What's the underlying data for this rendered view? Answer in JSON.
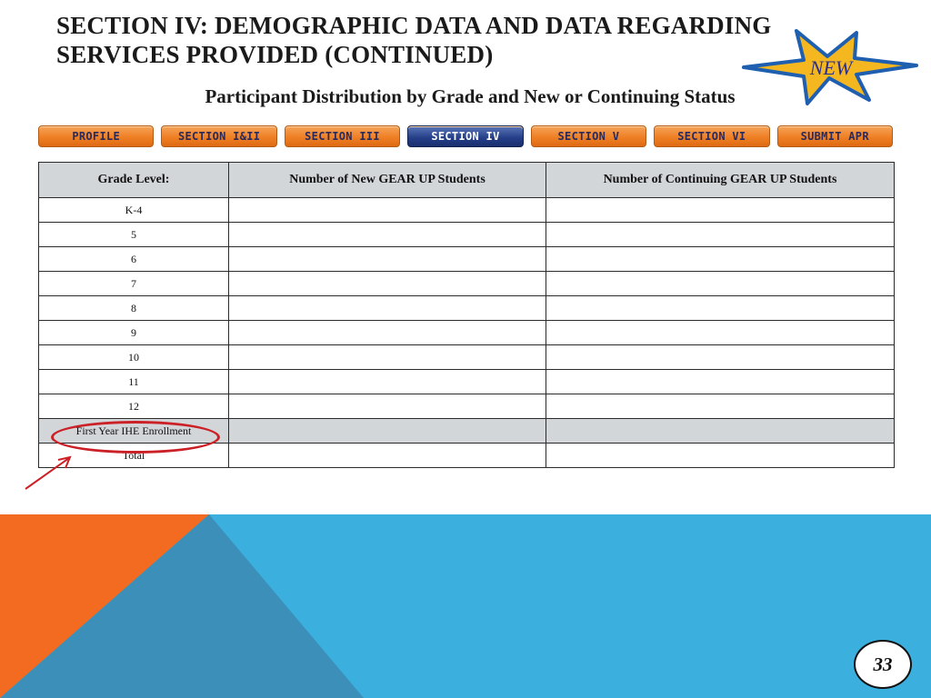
{
  "title": "SECTION IV: DEMOGRAPHIC DATA AND DATA REGARDING SERVICES PROVIDED (CONTINUED)",
  "subtitle": "Participant Distribution by Grade and New or Continuing Status",
  "badge": {
    "label": "NEW",
    "icon": "starburst-icon"
  },
  "nav": {
    "tabs": [
      {
        "label": "PROFILE"
      },
      {
        "label": "SECTION I&II"
      },
      {
        "label": "SECTION III"
      },
      {
        "label": "SECTION IV",
        "active": true
      },
      {
        "label": "SECTION V"
      },
      {
        "label": "SECTION VI"
      },
      {
        "label": "SUBMIT APR"
      }
    ]
  },
  "table": {
    "headers": [
      "Grade Level:",
      "Number of New GEAR UP Students",
      "Number of Continuing GEAR UP Students"
    ],
    "rows": [
      {
        "grade": "K-4",
        "new": "",
        "continuing": ""
      },
      {
        "grade": "5",
        "new": "",
        "continuing": ""
      },
      {
        "grade": "6",
        "new": "",
        "continuing": ""
      },
      {
        "grade": "7",
        "new": "",
        "continuing": ""
      },
      {
        "grade": "8",
        "new": "",
        "continuing": ""
      },
      {
        "grade": "9",
        "new": "",
        "continuing": ""
      },
      {
        "grade": "10",
        "new": "",
        "continuing": ""
      },
      {
        "grade": "11",
        "new": "",
        "continuing": ""
      },
      {
        "grade": "12",
        "new": "",
        "continuing": ""
      },
      {
        "grade": "First Year IHE Enrollment",
        "new": "",
        "continuing": "",
        "shaded": true,
        "highlighted": true
      },
      {
        "grade": "Total",
        "new": "",
        "continuing": ""
      }
    ]
  },
  "page_number": "33",
  "colors": {
    "accent_orange": "#f26b21",
    "accent_blue": "#3bb0de",
    "accent_dark_blue": "#3b8fb9",
    "highlight_red": "#cc2027",
    "header_gray": "#d3d6d9",
    "tab_active": "#233d86"
  }
}
